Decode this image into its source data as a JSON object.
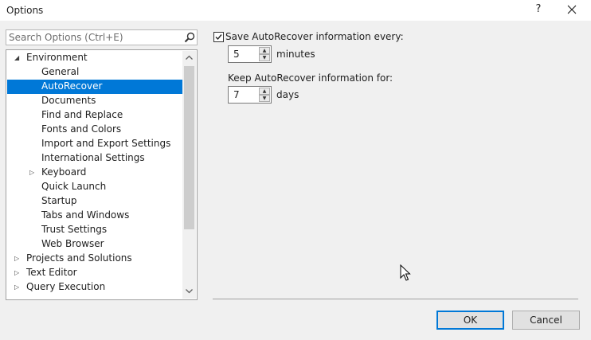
{
  "window": {
    "title": "Options",
    "help_label": "?"
  },
  "search": {
    "placeholder": "Search Options (Ctrl+E)"
  },
  "tree": {
    "items": [
      {
        "label": "Environment",
        "level": 0,
        "expander": "expanded"
      },
      {
        "label": "General",
        "level": 1,
        "expander": "none"
      },
      {
        "label": "AutoRecover",
        "level": 1,
        "expander": "none",
        "selected": true
      },
      {
        "label": "Documents",
        "level": 1,
        "expander": "none"
      },
      {
        "label": "Find and Replace",
        "level": 1,
        "expander": "none"
      },
      {
        "label": "Fonts and Colors",
        "level": 1,
        "expander": "none"
      },
      {
        "label": "Import and Export Settings",
        "level": 1,
        "expander": "none"
      },
      {
        "label": "International Settings",
        "level": 1,
        "expander": "none"
      },
      {
        "label": "Keyboard",
        "level": 1,
        "expander": "collapsed"
      },
      {
        "label": "Quick Launch",
        "level": 1,
        "expander": "none"
      },
      {
        "label": "Startup",
        "level": 1,
        "expander": "none"
      },
      {
        "label": "Tabs and Windows",
        "level": 1,
        "expander": "none"
      },
      {
        "label": "Trust Settings",
        "level": 1,
        "expander": "none"
      },
      {
        "label": "Web Browser",
        "level": 1,
        "expander": "none"
      },
      {
        "label": "Projects and Solutions",
        "level": 0,
        "expander": "collapsed"
      },
      {
        "label": "Text Editor",
        "level": 0,
        "expander": "collapsed"
      },
      {
        "label": "Query Execution",
        "level": 0,
        "expander": "collapsed"
      }
    ]
  },
  "autorecover": {
    "save_label": "Save AutoRecover information every:",
    "save_checked": true,
    "save_value": "5",
    "save_unit": "minutes",
    "keep_label": "Keep AutoRecover information for:",
    "keep_value": "7",
    "keep_unit": "days"
  },
  "buttons": {
    "ok": "OK",
    "cancel": "Cancel"
  },
  "colors": {
    "accent": "#0078d7",
    "window_bg": "#f0f0f0"
  }
}
